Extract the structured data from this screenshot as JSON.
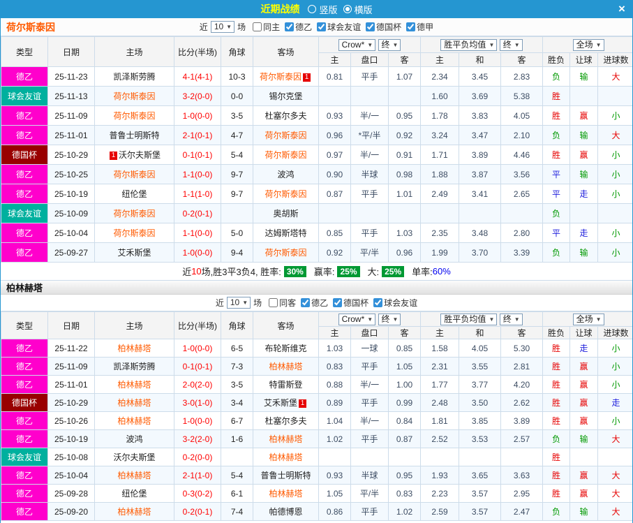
{
  "topbar": {
    "title": "近期战绩",
    "layout_options": [
      {
        "label": "竖版",
        "selected": false
      },
      {
        "label": "横版",
        "selected": true
      }
    ]
  },
  "icons": {
    "chevron_down": "▼",
    "close": "×"
  },
  "card_badge": "1",
  "cols": {
    "type": "类型",
    "date": "日期",
    "home": "主场",
    "score": "比分(半场)",
    "corner": "角球",
    "away": "客场",
    "ah_home": "主",
    "ah_line": "盘口",
    "ah_away": "客",
    "eu_home": "主",
    "eu_draw": "和",
    "eu_away": "客",
    "wdl": "胜负",
    "handicap_res": "让球",
    "goals": "进球数",
    "dd_provider": "Crow*",
    "dd_final": "终",
    "dd_avg": "胜平负均值",
    "dd_full": "全场"
  },
  "colors": {
    "frame": "#2596d1",
    "topbar_bg": "#2596d1",
    "title_yellow": "#ffff00",
    "border": "#cddcea",
    "header_bg": "#f4f4f4",
    "row_alt": "#f3f9fe",
    "de2": "#ff00cc",
    "friendly": "#00b09e",
    "cup": "#990000",
    "featured": "#ff5a00",
    "score_red": "#ff0000",
    "odds_text": "#3d4d63",
    "res_red": "#e60000",
    "res_green": "#009900",
    "res_blue": "#2020dd",
    "badge_green": "#009933",
    "single_blue": "#0000ee"
  },
  "sections": [
    {
      "team": "荷尔斯泰因",
      "filter": {
        "near": "近",
        "count": "10",
        "games": "场",
        "checks": [
          {
            "label": "同主",
            "checked": false
          },
          {
            "label": "德乙",
            "checked": true
          },
          {
            "label": "球会友谊",
            "checked": true
          },
          {
            "label": "德国杯",
            "checked": true
          },
          {
            "label": "德甲",
            "checked": true
          }
        ]
      },
      "rows": [
        {
          "type": {
            "label": "德乙",
            "color": "de2"
          },
          "date": "25-11-23",
          "home": {
            "name": "凯泽斯劳腾",
            "featured": false,
            "card": "none"
          },
          "score": "4-1(4-1)",
          "corner": "10-3",
          "away": {
            "name": "荷尔斯泰因",
            "featured": true,
            "card": "after"
          },
          "ah": [
            "0.81",
            "平手",
            "1.07"
          ],
          "eu": [
            "2.34",
            "3.45",
            "2.83"
          ],
          "res": [
            {
              "t": "负",
              "c": "green"
            },
            {
              "t": "输",
              "c": "green"
            },
            {
              "t": "大",
              "c": "red"
            }
          ]
        },
        {
          "type": {
            "label": "球会友谊",
            "color": "friendly"
          },
          "date": "25-11-13",
          "home": {
            "name": "荷尔斯泰因",
            "featured": true,
            "card": "none"
          },
          "score": "3-2(0-0)",
          "corner": "0-0",
          "away": {
            "name": "锡尔克堡",
            "featured": false,
            "card": "none"
          },
          "ah": [
            "",
            "",
            ""
          ],
          "eu": [
            "1.60",
            "3.69",
            "5.38"
          ],
          "res": [
            {
              "t": "胜",
              "c": "red"
            },
            null,
            null
          ]
        },
        {
          "type": {
            "label": "德乙",
            "color": "de2"
          },
          "date": "25-11-09",
          "home": {
            "name": "荷尔斯泰因",
            "featured": true,
            "card": "none"
          },
          "score": "1-0(0-0)",
          "corner": "3-5",
          "away": {
            "name": "杜塞尔多夫",
            "featured": false,
            "card": "none"
          },
          "ah": [
            "0.93",
            "半/一",
            "0.95"
          ],
          "eu": [
            "1.78",
            "3.83",
            "4.05"
          ],
          "res": [
            {
              "t": "胜",
              "c": "red"
            },
            {
              "t": "赢",
              "c": "red"
            },
            {
              "t": "小",
              "c": "green"
            }
          ]
        },
        {
          "type": {
            "label": "德乙",
            "color": "de2"
          },
          "date": "25-11-01",
          "home": {
            "name": "普鲁士明斯特",
            "featured": false,
            "card": "none"
          },
          "score": "2-1(0-1)",
          "corner": "4-7",
          "away": {
            "name": "荷尔斯泰因",
            "featured": true,
            "card": "none"
          },
          "ah": [
            "0.96",
            "*平/半",
            "0.92"
          ],
          "eu": [
            "3.24",
            "3.47",
            "2.10"
          ],
          "res": [
            {
              "t": "负",
              "c": "green"
            },
            {
              "t": "输",
              "c": "green"
            },
            {
              "t": "大",
              "c": "red"
            }
          ]
        },
        {
          "type": {
            "label": "德国杯",
            "color": "cup"
          },
          "date": "25-10-29",
          "home": {
            "name": "沃尔夫斯堡",
            "featured": false,
            "card": "before"
          },
          "score": "0-1(0-1)",
          "corner": "5-4",
          "away": {
            "name": "荷尔斯泰因",
            "featured": true,
            "card": "none"
          },
          "ah": [
            "0.97",
            "半/一",
            "0.91"
          ],
          "eu": [
            "1.71",
            "3.89",
            "4.46"
          ],
          "res": [
            {
              "t": "胜",
              "c": "red"
            },
            {
              "t": "赢",
              "c": "red"
            },
            {
              "t": "小",
              "c": "green"
            }
          ]
        },
        {
          "type": {
            "label": "德乙",
            "color": "de2"
          },
          "date": "25-10-25",
          "home": {
            "name": "荷尔斯泰因",
            "featured": true,
            "card": "none"
          },
          "score": "1-1(0-0)",
          "corner": "9-7",
          "away": {
            "name": "波鸿",
            "featured": false,
            "card": "none"
          },
          "ah": [
            "0.90",
            "半球",
            "0.98"
          ],
          "eu": [
            "1.88",
            "3.87",
            "3.56"
          ],
          "res": [
            {
              "t": "平",
              "c": "blue"
            },
            {
              "t": "输",
              "c": "green"
            },
            {
              "t": "小",
              "c": "green"
            }
          ]
        },
        {
          "type": {
            "label": "德乙",
            "color": "de2"
          },
          "date": "25-10-19",
          "home": {
            "name": "纽伦堡",
            "featured": false,
            "card": "none"
          },
          "score": "1-1(1-0)",
          "corner": "9-7",
          "away": {
            "name": "荷尔斯泰因",
            "featured": true,
            "card": "none"
          },
          "ah": [
            "0.87",
            "平手",
            "1.01"
          ],
          "eu": [
            "2.49",
            "3.41",
            "2.65"
          ],
          "res": [
            {
              "t": "平",
              "c": "blue"
            },
            {
              "t": "走",
              "c": "blue"
            },
            {
              "t": "小",
              "c": "green"
            }
          ]
        },
        {
          "type": {
            "label": "球会友谊",
            "color": "friendly"
          },
          "date": "25-10-09",
          "home": {
            "name": "荷尔斯泰因",
            "featured": true,
            "card": "none"
          },
          "score": "0-2(0-1)",
          "corner": "",
          "away": {
            "name": "奥胡斯",
            "featured": false,
            "card": "none"
          },
          "ah": [
            "",
            "",
            ""
          ],
          "eu": [
            "",
            "",
            ""
          ],
          "res": [
            {
              "t": "负",
              "c": "green"
            },
            null,
            null
          ]
        },
        {
          "type": {
            "label": "德乙",
            "color": "de2"
          },
          "date": "25-10-04",
          "home": {
            "name": "荷尔斯泰因",
            "featured": true,
            "card": "none"
          },
          "score": "1-1(0-0)",
          "corner": "5-0",
          "away": {
            "name": "达姆斯塔特",
            "featured": false,
            "card": "none"
          },
          "ah": [
            "0.85",
            "平手",
            "1.03"
          ],
          "eu": [
            "2.35",
            "3.48",
            "2.80"
          ],
          "res": [
            {
              "t": "平",
              "c": "blue"
            },
            {
              "t": "走",
              "c": "blue"
            },
            {
              "t": "小",
              "c": "green"
            }
          ]
        },
        {
          "type": {
            "label": "德乙",
            "color": "de2"
          },
          "date": "25-09-27",
          "home": {
            "name": "艾禾斯堡",
            "featured": false,
            "card": "none"
          },
          "score": "1-0(0-0)",
          "corner": "9-4",
          "away": {
            "name": "荷尔斯泰因",
            "featured": true,
            "card": "none"
          },
          "ah": [
            "0.92",
            "平/半",
            "0.96"
          ],
          "eu": [
            "1.99",
            "3.70",
            "3.39"
          ],
          "res": [
            {
              "t": "负",
              "c": "green"
            },
            {
              "t": "输",
              "c": "green"
            },
            {
              "t": "小",
              "c": "green"
            }
          ]
        }
      ],
      "summary": {
        "near": "近",
        "count": "10",
        "record": "场,胜3平3负4, 胜率:",
        "win_rate": "30%",
        "handicap_label": "赢率:",
        "handicap_rate": "25%",
        "big_label": "大:",
        "big_rate": "25%",
        "single_label": "单率:",
        "single_rate": "60%"
      }
    },
    {
      "team": "柏林赫塔",
      "filter": {
        "near": "近",
        "count": "10",
        "games": "场",
        "checks": [
          {
            "label": "同客",
            "checked": false
          },
          {
            "label": "德乙",
            "checked": true
          },
          {
            "label": "德国杯",
            "checked": true
          },
          {
            "label": "球会友谊",
            "checked": true
          }
        ]
      },
      "rows": [
        {
          "type": {
            "label": "德乙",
            "color": "de2"
          },
          "date": "25-11-22",
          "home": {
            "name": "柏林赫塔",
            "featured": true,
            "card": "none"
          },
          "score": "1-0(0-0)",
          "corner": "6-5",
          "away": {
            "name": "布轮斯维克",
            "featured": false,
            "card": "none"
          },
          "ah": [
            "1.03",
            "一球",
            "0.85"
          ],
          "eu": [
            "1.58",
            "4.05",
            "5.30"
          ],
          "res": [
            {
              "t": "胜",
              "c": "red"
            },
            {
              "t": "走",
              "c": "blue"
            },
            {
              "t": "小",
              "c": "green"
            }
          ]
        },
        {
          "type": {
            "label": "德乙",
            "color": "de2"
          },
          "date": "25-11-09",
          "home": {
            "name": "凯泽斯劳腾",
            "featured": false,
            "card": "none"
          },
          "score": "0-1(0-1)",
          "corner": "7-3",
          "away": {
            "name": "柏林赫塔",
            "featured": true,
            "card": "none"
          },
          "ah": [
            "0.83",
            "平手",
            "1.05"
          ],
          "eu": [
            "2.31",
            "3.55",
            "2.81"
          ],
          "res": [
            {
              "t": "胜",
              "c": "red"
            },
            {
              "t": "赢",
              "c": "red"
            },
            {
              "t": "小",
              "c": "green"
            }
          ]
        },
        {
          "type": {
            "label": "德乙",
            "color": "de2"
          },
          "date": "25-11-01",
          "home": {
            "name": "柏林赫塔",
            "featured": true,
            "card": "none"
          },
          "score": "2-0(2-0)",
          "corner": "3-5",
          "away": {
            "name": "特雷斯登",
            "featured": false,
            "card": "none"
          },
          "ah": [
            "0.88",
            "半/一",
            "1.00"
          ],
          "eu": [
            "1.77",
            "3.77",
            "4.20"
          ],
          "res": [
            {
              "t": "胜",
              "c": "red"
            },
            {
              "t": "赢",
              "c": "red"
            },
            {
              "t": "小",
              "c": "green"
            }
          ]
        },
        {
          "type": {
            "label": "德国杯",
            "color": "cup"
          },
          "date": "25-10-29",
          "home": {
            "name": "柏林赫塔",
            "featured": true,
            "card": "none"
          },
          "score": "3-0(1-0)",
          "corner": "3-4",
          "away": {
            "name": "艾禾斯堡",
            "featured": false,
            "card": "after"
          },
          "ah": [
            "0.89",
            "平手",
            "0.99"
          ],
          "eu": [
            "2.48",
            "3.50",
            "2.62"
          ],
          "res": [
            {
              "t": "胜",
              "c": "red"
            },
            {
              "t": "赢",
              "c": "red"
            },
            {
              "t": "走",
              "c": "blue"
            }
          ]
        },
        {
          "type": {
            "label": "德乙",
            "color": "de2"
          },
          "date": "25-10-26",
          "home": {
            "name": "柏林赫塔",
            "featured": true,
            "card": "none"
          },
          "score": "1-0(0-0)",
          "corner": "6-7",
          "away": {
            "name": "杜塞尔多夫",
            "featured": false,
            "card": "none"
          },
          "ah": [
            "1.04",
            "半/一",
            "0.84"
          ],
          "eu": [
            "1.81",
            "3.85",
            "3.89"
          ],
          "res": [
            {
              "t": "胜",
              "c": "red"
            },
            {
              "t": "赢",
              "c": "red"
            },
            {
              "t": "小",
              "c": "green"
            }
          ]
        },
        {
          "type": {
            "label": "德乙",
            "color": "de2"
          },
          "date": "25-10-19",
          "home": {
            "name": "波鸿",
            "featured": false,
            "card": "none"
          },
          "score": "3-2(2-0)",
          "corner": "1-6",
          "away": {
            "name": "柏林赫塔",
            "featured": true,
            "card": "none"
          },
          "ah": [
            "1.02",
            "平手",
            "0.87"
          ],
          "eu": [
            "2.52",
            "3.53",
            "2.57"
          ],
          "res": [
            {
              "t": "负",
              "c": "green"
            },
            {
              "t": "输",
              "c": "green"
            },
            {
              "t": "大",
              "c": "red"
            }
          ]
        },
        {
          "type": {
            "label": "球会友谊",
            "color": "friendly"
          },
          "date": "25-10-08",
          "home": {
            "name": "沃尔夫斯堡",
            "featured": false,
            "card": "none"
          },
          "score": "0-2(0-0)",
          "corner": "",
          "away": {
            "name": "柏林赫塔",
            "featured": true,
            "card": "none"
          },
          "ah": [
            "",
            "",
            ""
          ],
          "eu": [
            "",
            "",
            ""
          ],
          "res": [
            {
              "t": "胜",
              "c": "red"
            },
            null,
            null
          ]
        },
        {
          "type": {
            "label": "德乙",
            "color": "de2"
          },
          "date": "25-10-04",
          "home": {
            "name": "柏林赫塔",
            "featured": true,
            "card": "none"
          },
          "score": "2-1(1-0)",
          "corner": "5-4",
          "away": {
            "name": "普鲁士明斯特",
            "featured": false,
            "card": "none"
          },
          "ah": [
            "0.93",
            "半球",
            "0.95"
          ],
          "eu": [
            "1.93",
            "3.65",
            "3.63"
          ],
          "res": [
            {
              "t": "胜",
              "c": "red"
            },
            {
              "t": "赢",
              "c": "red"
            },
            {
              "t": "大",
              "c": "red"
            }
          ]
        },
        {
          "type": {
            "label": "德乙",
            "color": "de2"
          },
          "date": "25-09-28",
          "home": {
            "name": "纽伦堡",
            "featured": false,
            "card": "none"
          },
          "score": "0-3(0-2)",
          "corner": "6-1",
          "away": {
            "name": "柏林赫塔",
            "featured": true,
            "card": "none"
          },
          "ah": [
            "1.05",
            "平/半",
            "0.83"
          ],
          "eu": [
            "2.23",
            "3.57",
            "2.95"
          ],
          "res": [
            {
              "t": "胜",
              "c": "red"
            },
            {
              "t": "赢",
              "c": "red"
            },
            {
              "t": "大",
              "c": "red"
            }
          ]
        },
        {
          "type": {
            "label": "德乙",
            "color": "de2"
          },
          "date": "25-09-20",
          "home": {
            "name": "柏林赫塔",
            "featured": true,
            "card": "none"
          },
          "score": "0-2(0-1)",
          "corner": "7-4",
          "away": {
            "name": "帕德博恩",
            "featured": false,
            "card": "none"
          },
          "ah": [
            "0.86",
            "平手",
            "1.02"
          ],
          "eu": [
            "2.59",
            "3.57",
            "2.47"
          ],
          "res": [
            {
              "t": "负",
              "c": "green"
            },
            {
              "t": "输",
              "c": "green"
            },
            {
              "t": "大",
              "c": "red"
            }
          ]
        }
      ]
    }
  ]
}
